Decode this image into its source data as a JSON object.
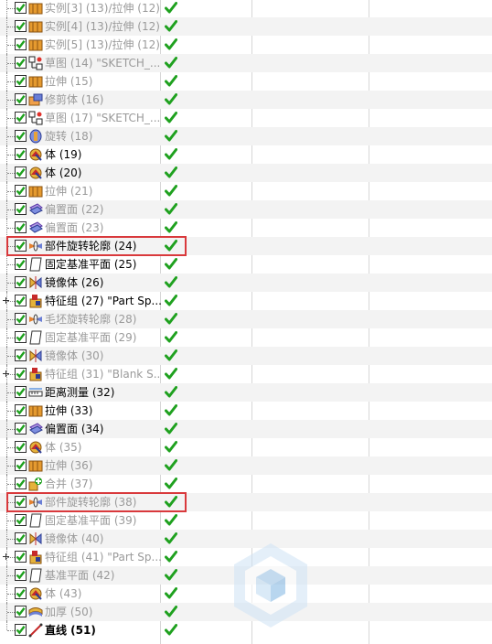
{
  "rows": [
    {
      "label": "实例[3] (13)/拉伸 (12)",
      "icon": "extrude-icon",
      "state": "suppressed"
    },
    {
      "label": "实例[4] (13)/拉伸 (12)",
      "icon": "extrude-icon",
      "state": "suppressed"
    },
    {
      "label": "实例[5] (13)/拉伸 (12)",
      "icon": "extrude-icon",
      "state": "suppressed"
    },
    {
      "label": "草图 (14) \"SKETCH_...",
      "icon": "sketch-icon",
      "state": "suppressed"
    },
    {
      "label": "拉伸 (15)",
      "icon": "extrude-icon",
      "state": "suppressed"
    },
    {
      "label": "修剪体 (16)",
      "icon": "trim-body-icon",
      "state": "suppressed"
    },
    {
      "label": "草图 (17) \"SKETCH_...",
      "icon": "sketch-icon",
      "state": "suppressed"
    },
    {
      "label": "旋转 (18)",
      "icon": "revolve-icon",
      "state": "suppressed"
    },
    {
      "label": "体 (19)",
      "icon": "body-icon",
      "state": "active"
    },
    {
      "label": "体 (20)",
      "icon": "body-icon",
      "state": "active"
    },
    {
      "label": "拉伸 (21)",
      "icon": "extrude-icon",
      "state": "suppressed"
    },
    {
      "label": "偏置面 (22)",
      "icon": "offset-face-icon",
      "state": "suppressed"
    },
    {
      "label": "偏置面 (23)",
      "icon": "offset-face-icon",
      "state": "suppressed"
    },
    {
      "label": "部件旋转轮廓 (24)",
      "icon": "revolve-profile-icon",
      "state": "active"
    },
    {
      "label": "固定基准平面 (25)",
      "icon": "datum-plane-icon",
      "state": "active"
    },
    {
      "label": "镜像体 (26)",
      "icon": "mirror-body-icon",
      "state": "active"
    },
    {
      "label": "特征组 (27) \"Part Sp...",
      "icon": "feature-group-icon",
      "state": "active",
      "expandable": true
    },
    {
      "label": "毛坯旋转轮廓 (28)",
      "icon": "revolve-profile-icon",
      "state": "suppressed"
    },
    {
      "label": "固定基准平面 (29)",
      "icon": "datum-plane-icon",
      "state": "suppressed"
    },
    {
      "label": "镜像体 (30)",
      "icon": "mirror-body-icon",
      "state": "suppressed"
    },
    {
      "label": "特征组 (31) \"Blank S...",
      "icon": "feature-group-icon",
      "state": "suppressed",
      "expandable": true
    },
    {
      "label": "距离测量 (32)",
      "icon": "distance-measure-icon",
      "state": "active"
    },
    {
      "label": "拉伸 (33)",
      "icon": "extrude-icon",
      "state": "active"
    },
    {
      "label": "偏置面 (34)",
      "icon": "offset-face-icon",
      "state": "active"
    },
    {
      "label": "体 (35)",
      "icon": "body-icon",
      "state": "suppressed"
    },
    {
      "label": "拉伸 (36)",
      "icon": "extrude-icon",
      "state": "suppressed"
    },
    {
      "label": "合并 (37)",
      "icon": "unite-icon",
      "state": "suppressed"
    },
    {
      "label": "部件旋转轮廓 (38)",
      "icon": "revolve-profile-icon",
      "state": "suppressed"
    },
    {
      "label": "固定基准平面 (39)",
      "icon": "datum-plane-icon",
      "state": "suppressed"
    },
    {
      "label": "镜像体 (40)",
      "icon": "mirror-body-icon",
      "state": "suppressed"
    },
    {
      "label": "特征组 (41) \"Part Sp...",
      "icon": "feature-group-icon",
      "state": "suppressed",
      "expandable": true
    },
    {
      "label": "基准平面 (42)",
      "icon": "datum-plane-icon",
      "state": "suppressed"
    },
    {
      "label": "体 (43)",
      "icon": "body-icon",
      "state": "suppressed"
    },
    {
      "label": "加厚 (50)",
      "icon": "thicken-icon",
      "state": "suppressed"
    },
    {
      "label": "直线 (51)",
      "icon": "line-icon",
      "state": "current"
    }
  ],
  "highlighted_rows": [
    13,
    27
  ],
  "colors": {
    "check_green": "#1fa11f",
    "highlight_red": "#d9393c",
    "suppressed_text": "#9a9a9a",
    "alt_row": "#f3f3f3"
  }
}
